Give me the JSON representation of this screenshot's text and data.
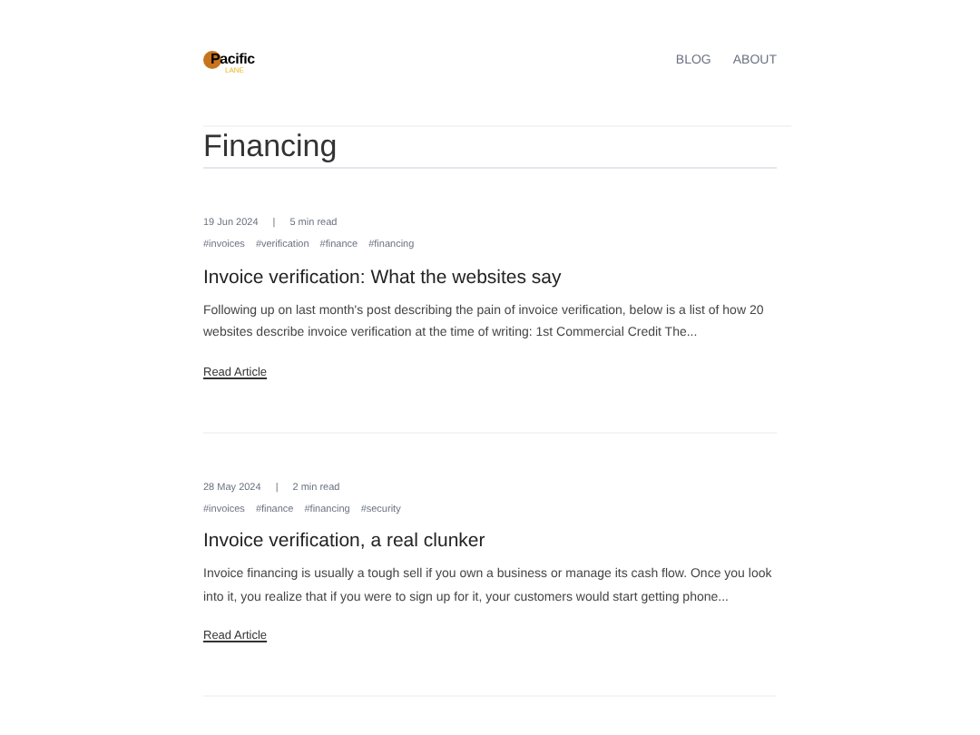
{
  "logo": {
    "name": "Pacific",
    "tagline": "LANE"
  },
  "nav": [
    "BLOG",
    "ABOUT"
  ],
  "page_title": "Financing",
  "articles": [
    {
      "date": "19 Jun 2024",
      "separator": "|",
      "read_time": "5 min read",
      "tags": [
        "#invoices",
        "#verification",
        "#finance",
        "#financing"
      ],
      "title": "Invoice verification: What the websites say",
      "excerpt": "Following up on last month's post describing the pain of invoice verification, below is a list of how 20 websites describe invoice verification at the time of writing: 1st Commercial Credit The...",
      "link": "Read Article"
    },
    {
      "date": "28 May 2024",
      "separator": "|",
      "read_time": "2 min read",
      "tags": [
        "#invoices",
        "#finance",
        "#financing",
        "#security"
      ],
      "title": "Invoice verification, a real clunker",
      "excerpt": "Invoice financing is usually a tough sell if you own a business or manage its cash flow. Once you look into it, you realize that if you were to sign up for it, your customers would start getting phone...",
      "link": "Read Article"
    }
  ]
}
